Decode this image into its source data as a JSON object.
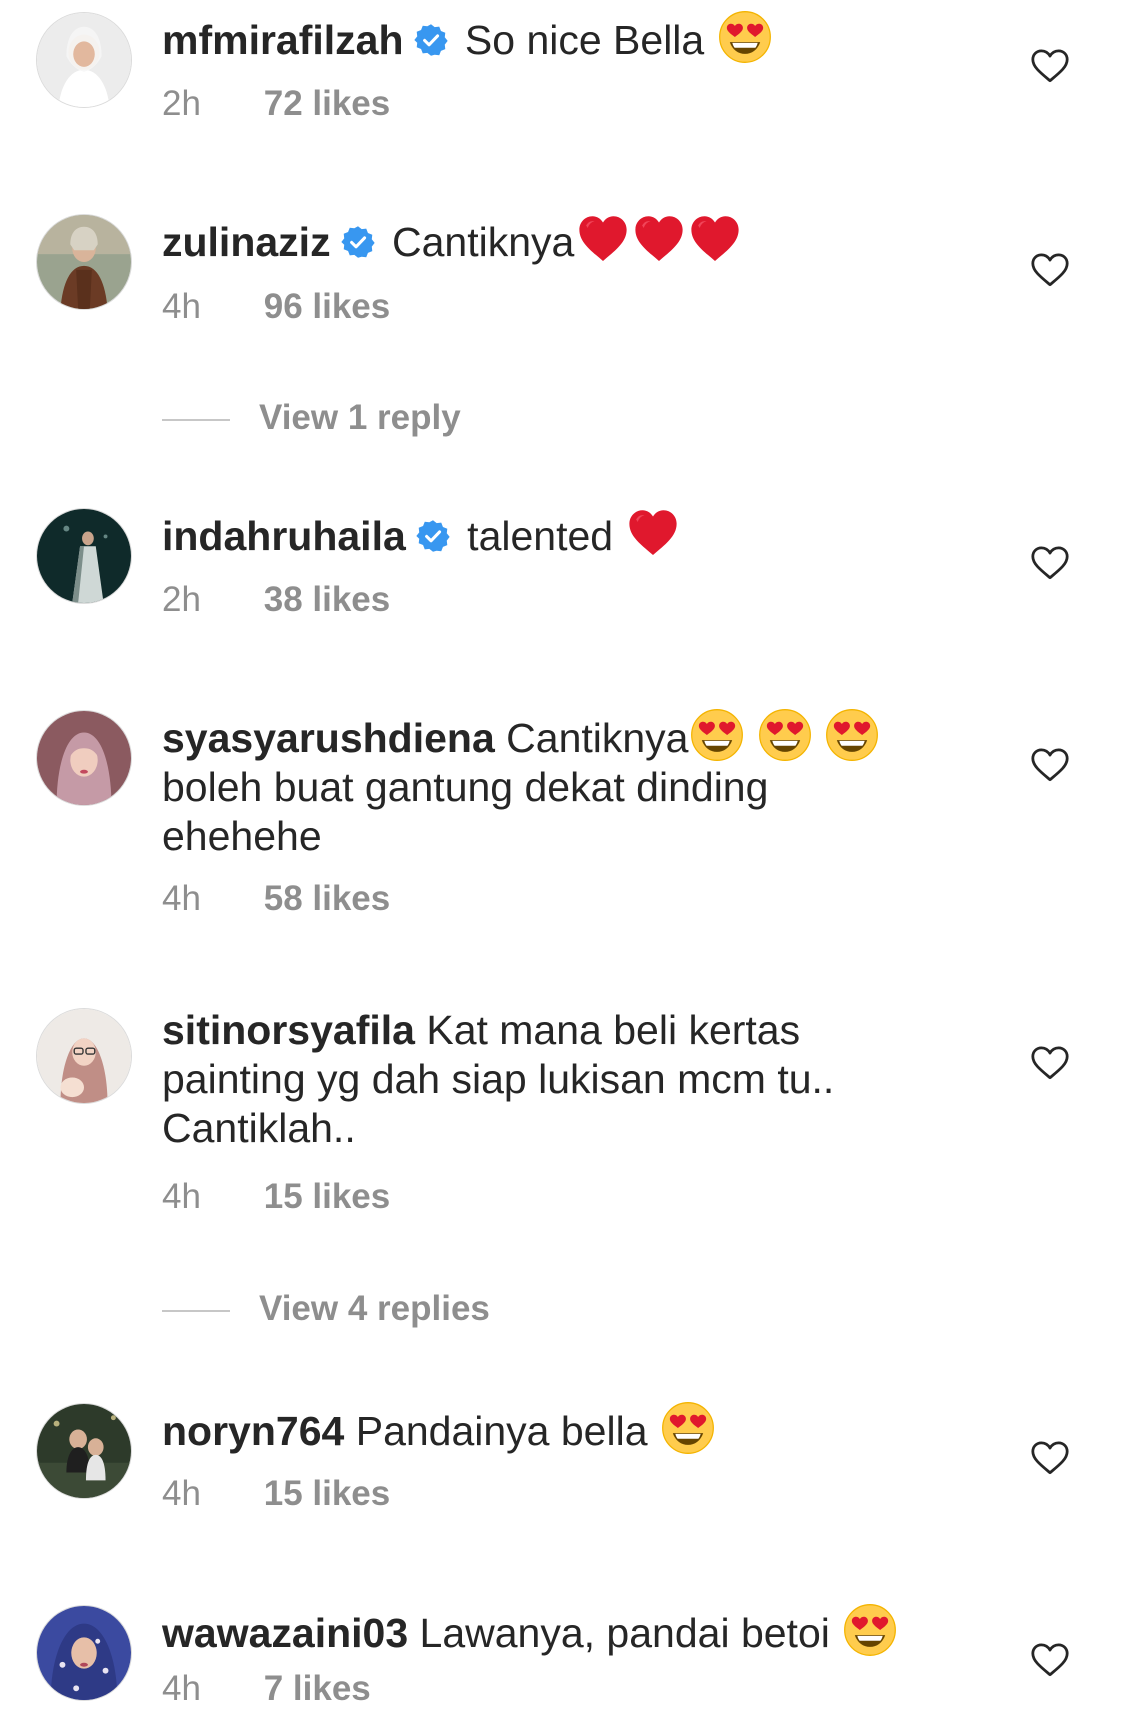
{
  "comments": [
    {
      "username": "mfmirafilzah",
      "verified": true,
      "text": "So nice Bella",
      "emojis": [
        "heart-eyes"
      ],
      "time": "2h",
      "likes": "72 likes"
    },
    {
      "username": "zulinaziz",
      "verified": true,
      "text": "Cantiknya",
      "emojis": [
        "red-heart",
        "red-heart",
        "red-heart"
      ],
      "time": "4h",
      "likes": "96 likes",
      "replies": "View 1 reply"
    },
    {
      "username": "indahruhaila",
      "verified": true,
      "text": "talented",
      "emojis": [
        "red-heart"
      ],
      "time": "2h",
      "likes": "38 likes"
    },
    {
      "username": "syasyarushdiena",
      "verified": false,
      "text": "Cantiknya",
      "emojis": [
        "heart-eyes",
        "heart-eyes",
        "heart-eyes"
      ],
      "text2": "boleh buat gantung dekat dinding ehehehe",
      "time": "4h",
      "likes": "58 likes"
    },
    {
      "username": "sitinorsyafila",
      "verified": false,
      "text": "Kat mana beli kertas painting yg dah siap lukisan mcm tu.. Cantiklah..",
      "time": "4h",
      "likes": "15 likes",
      "replies": "View 4 replies"
    },
    {
      "username": "noryn764",
      "verified": false,
      "text": "Pandainya bella",
      "emojis": [
        "heart-eyes"
      ],
      "time": "4h",
      "likes": "15 likes"
    },
    {
      "username": "wawazaini03",
      "verified": false,
      "text": "Lawanya, pandai betoi",
      "emojis": [
        "heart-eyes"
      ],
      "time": "4h",
      "likes": "7 likes"
    }
  ],
  "colors": {
    "text": "#262626",
    "muted": "#8e8e8e",
    "verified": "#3897f0",
    "heart": "#e0182d",
    "emoji_face": "#ffcc4d"
  },
  "icons": {
    "verified": "verified-badge-icon",
    "like": "heart-outline-icon"
  }
}
